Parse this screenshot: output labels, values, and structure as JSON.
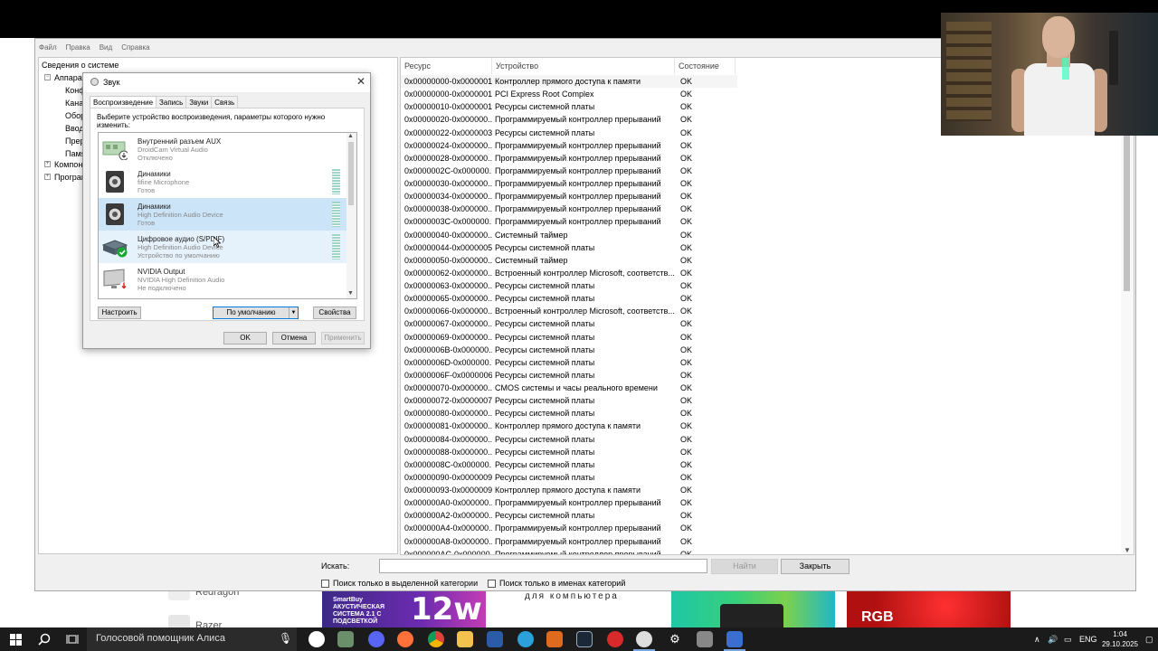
{
  "sysinfo": {
    "menu": [
      "Файл",
      "Правка",
      "Вид",
      "Справка"
    ],
    "tree": {
      "root": "Сведения о системе",
      "items": [
        {
          "label": "Аппарат",
          "level": 1,
          "toggle": "-"
        },
        {
          "label": "Конф",
          "level": 2
        },
        {
          "label": "Кана",
          "level": 2
        },
        {
          "label": "Обор",
          "level": 2
        },
        {
          "label": "Ввод",
          "level": 2
        },
        {
          "label": "Прер",
          "level": 2
        },
        {
          "label": "Памя",
          "level": 2
        },
        {
          "label": "Компоне",
          "level": 1,
          "toggle": "+"
        },
        {
          "label": "Програм",
          "level": 1,
          "toggle": "+"
        }
      ]
    },
    "columns": {
      "resource": "Ресурс",
      "device": "Устройство",
      "status": "Состояние"
    },
    "rows": [
      {
        "r": "0x00000000-0x0000001F",
        "d": "Контроллер прямого доступа к памяти",
        "s": "OK"
      },
      {
        "r": "0x00000000-0x0000001F",
        "d": "PCI Express Root Complex",
        "s": "OK"
      },
      {
        "r": "0x00000010-0x0000001F",
        "d": "Ресурсы системной платы",
        "s": "OK"
      },
      {
        "r": "0x00000020-0x000000...",
        "d": "Программируемый контроллер прерываний",
        "s": "OK"
      },
      {
        "r": "0x00000022-0x0000003F",
        "d": "Ресурсы системной платы",
        "s": "OK"
      },
      {
        "r": "0x00000024-0x000000...",
        "d": "Программируемый контроллер прерываний",
        "s": "OK"
      },
      {
        "r": "0x00000028-0x000000...",
        "d": "Программируемый контроллер прерываний",
        "s": "OK"
      },
      {
        "r": "0x0000002C-0x000000...",
        "d": "Программируемый контроллер прерываний",
        "s": "OK"
      },
      {
        "r": "0x00000030-0x000000...",
        "d": "Программируемый контроллер прерываний",
        "s": "OK"
      },
      {
        "r": "0x00000034-0x000000...",
        "d": "Программируемый контроллер прерываний",
        "s": "OK"
      },
      {
        "r": "0x00000038-0x000000...",
        "d": "Программируемый контроллер прерываний",
        "s": "OK"
      },
      {
        "r": "0x0000003C-0x000000...",
        "d": "Программируемый контроллер прерываний",
        "s": "OK"
      },
      {
        "r": "0x00000040-0x000000...",
        "d": "Системный таймер",
        "s": "OK"
      },
      {
        "r": "0x00000044-0x0000005F",
        "d": "Ресурсы системной платы",
        "s": "OK"
      },
      {
        "r": "0x00000050-0x000000...",
        "d": "Системный таймер",
        "s": "OK"
      },
      {
        "r": "0x00000062-0x000000...",
        "d": "Встроенный контроллер Microsoft, соответств...",
        "s": "OK"
      },
      {
        "r": "0x00000063-0x000000...",
        "d": "Ресурсы системной платы",
        "s": "OK"
      },
      {
        "r": "0x00000065-0x000000...",
        "d": "Ресурсы системной платы",
        "s": "OK"
      },
      {
        "r": "0x00000066-0x000000...",
        "d": "Встроенный контроллер Microsoft, соответств...",
        "s": "OK"
      },
      {
        "r": "0x00000067-0x000000...",
        "d": "Ресурсы системной платы",
        "s": "OK"
      },
      {
        "r": "0x00000069-0x000000...",
        "d": "Ресурсы системной платы",
        "s": "OK"
      },
      {
        "r": "0x0000006B-0x000000...",
        "d": "Ресурсы системной платы",
        "s": "OK"
      },
      {
        "r": "0x0000006D-0x000000...",
        "d": "Ресурсы системной платы",
        "s": "OK"
      },
      {
        "r": "0x0000006F-0x0000006F",
        "d": "Ресурсы системной платы",
        "s": "OK"
      },
      {
        "r": "0x00000070-0x000000...",
        "d": "CMOS системы и часы реального времени",
        "s": "OK"
      },
      {
        "r": "0x00000072-0x0000007F",
        "d": "Ресурсы системной платы",
        "s": "OK"
      },
      {
        "r": "0x00000080-0x000000...",
        "d": "Ресурсы системной платы",
        "s": "OK"
      },
      {
        "r": "0x00000081-0x000000...",
        "d": "Контроллер прямого доступа к памяти",
        "s": "OK"
      },
      {
        "r": "0x00000084-0x000000...",
        "d": "Ресурсы системной платы",
        "s": "OK"
      },
      {
        "r": "0x00000088-0x000000...",
        "d": "Ресурсы системной платы",
        "s": "OK"
      },
      {
        "r": "0x0000008C-0x000000...",
        "d": "Ресурсы системной платы",
        "s": "OK"
      },
      {
        "r": "0x00000090-0x0000009F",
        "d": "Ресурсы системной платы",
        "s": "OK"
      },
      {
        "r": "0x00000093-0x0000009F",
        "d": "Контроллер прямого доступа к памяти",
        "s": "OK"
      },
      {
        "r": "0x000000A0-0x000000...",
        "d": "Программируемый контроллер прерываний",
        "s": "OK"
      },
      {
        "r": "0x000000A2-0x000000...",
        "d": "Ресурсы системной платы",
        "s": "OK"
      },
      {
        "r": "0x000000A4-0x000000...",
        "d": "Программируемый контроллер прерываний",
        "s": "OK"
      },
      {
        "r": "0x000000A8-0x000000...",
        "d": "Программируемый контроллер прерываний",
        "s": "OK"
      },
      {
        "r": "0x000000AC-0x000000...",
        "d": "Программируемый контроллер прерываний",
        "s": "OK"
      }
    ],
    "find": {
      "label": "Искать:",
      "value": "",
      "find_button": "Найти",
      "close_button": "Закрыть",
      "chk_category": "Поиск только в выделенной категории",
      "chk_names": "Поиск только в именах категорий"
    }
  },
  "sound": {
    "title": "Звук",
    "close": "✕",
    "tabs": [
      "Воспроизведение",
      "Запись",
      "Звуки",
      "Связь"
    ],
    "description": "Выберите устройство воспроизведения, параметры которого нужно изменить:",
    "devices": [
      {
        "name": "Внутренний разъем  AUX",
        "driver": "DroidCam Virtual Audio",
        "status": "Отключено",
        "icon": "aux-card-icon",
        "badge": "down-arrow",
        "state": "normal",
        "meter": false
      },
      {
        "name": "Динамики",
        "driver": "fifine Microphone",
        "status": "Готов",
        "icon": "speaker-icon",
        "badge": "",
        "state": "normal",
        "meter": true
      },
      {
        "name": "Динамики",
        "driver": "High Definition Audio Device",
        "status": "Готов",
        "icon": "speaker-icon",
        "badge": "",
        "state": "selected",
        "meter": true
      },
      {
        "name": "Цифровое аудио (S/PDIF)",
        "driver": "High Definition Audio Device",
        "status": "Устройство по умолчанию",
        "icon": "spdif-icon",
        "badge": "check",
        "state": "hover",
        "meter": true
      },
      {
        "name": "NVIDIA Output",
        "driver": "NVIDIA High Definition Audio",
        "status": "Не подключено",
        "icon": "monitor-icon",
        "badge": "red-arrow",
        "state": "normal",
        "meter": false
      }
    ],
    "buttons": {
      "configure": "Настроить",
      "set_default": "По умолчанию",
      "properties": "Свойства",
      "ok": "OK",
      "cancel": "Отмена",
      "apply": "Применить"
    }
  },
  "web_background": {
    "left_label_1": "Redragon",
    "left_label_2": "Razer",
    "thumb1_small": "SmartBuy АКУСТИЧЕСКАЯ СИСТЕМА 2.1 С ПОДСВЕТКОЙ",
    "thumb1_big": "12w",
    "thumb2_caption": "для компьютера",
    "thumb4_caption": "RGB"
  },
  "taskbar": {
    "search_text": "Голосовой помощник Алиса",
    "language": "ENG",
    "time": "1:04",
    "date": "29.10.2025"
  },
  "colors": {
    "selection": "#cce4f7",
    "hover": "#e5f1fb",
    "taskbar": "#1b1b1b",
    "default_button_border": "#0078d7"
  }
}
